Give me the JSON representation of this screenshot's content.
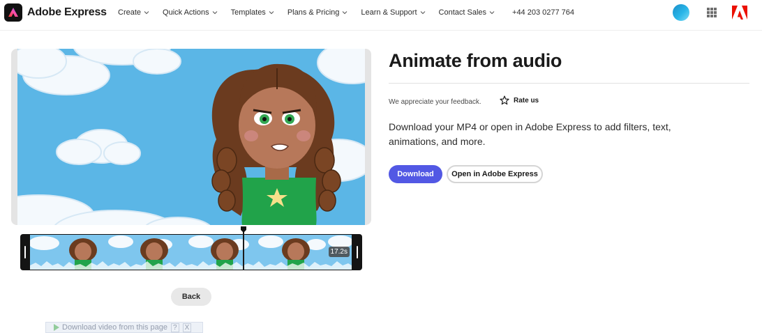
{
  "header": {
    "brand": "Adobe Express",
    "nav": [
      {
        "label": "Create"
      },
      {
        "label": "Quick Actions"
      },
      {
        "label": "Templates"
      },
      {
        "label": "Plans & Pricing"
      },
      {
        "label": "Learn & Support"
      },
      {
        "label": "Contact Sales"
      }
    ],
    "phone": "+44 203 0277 764"
  },
  "editor": {
    "duration": "17.2s",
    "back_label": "Back"
  },
  "extension_bar": {
    "text": "Download video from this page",
    "help": "?",
    "close": "X"
  },
  "panel": {
    "title": "Animate from audio",
    "feedback": "We appreciate your feedback.",
    "rate_label": "Rate us",
    "description": "Download your MP4 or open in Adobe Express to add filters, text, animations, and more.",
    "download_label": "Download",
    "open_label": "Open in Adobe Express"
  },
  "colors": {
    "primary_button": "#5258e4",
    "sky": "#5bb6e6",
    "timeline_bg": "#141414"
  }
}
